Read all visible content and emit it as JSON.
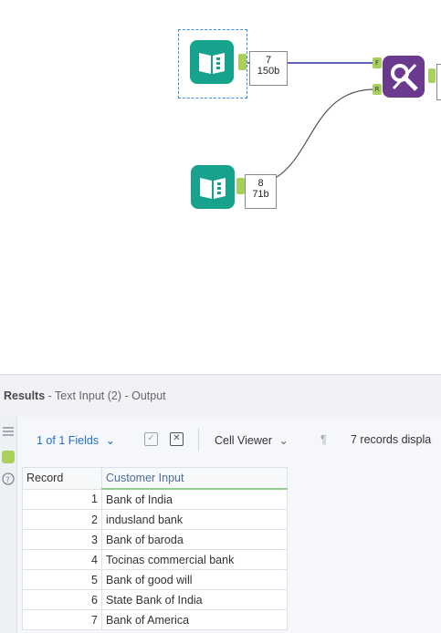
{
  "canvas": {
    "input_top": {
      "count": "7",
      "size": "150b"
    },
    "input_bottom": {
      "count": "8",
      "size": "71b"
    },
    "join_anchor_top": "F",
    "join_anchor_bottom": "R",
    "colors": {
      "input_tool": "#17a28d",
      "join_tool": "#6b3a8f",
      "connection_top": "#2a2fa0",
      "connection_bottom": "#555555",
      "anchor": "#a8d05a"
    },
    "icons": [
      "book-icon",
      "book-icon",
      "find-replace-icon"
    ]
  },
  "results": {
    "title_bold": "Results",
    "title_rest": " - Text Input (2) - Output",
    "toolbar": {
      "fields_label": "1 of 1 Fields",
      "cell_viewer_label": "Cell Viewer",
      "records_label": "7 records displa"
    },
    "columns": [
      "Record",
      "Customer Input"
    ],
    "rows": [
      {
        "record": "1",
        "value": "Bank of India"
      },
      {
        "record": "2",
        "value": "indusland bank"
      },
      {
        "record": "3",
        "value": "Bank of baroda"
      },
      {
        "record": "4",
        "value": "Tocinas commercial bank"
      },
      {
        "record": "5",
        "value": "Bank of good will"
      },
      {
        "record": "6",
        "value": "State Bank of India"
      },
      {
        "record": "7",
        "value": "Bank of America"
      }
    ]
  }
}
